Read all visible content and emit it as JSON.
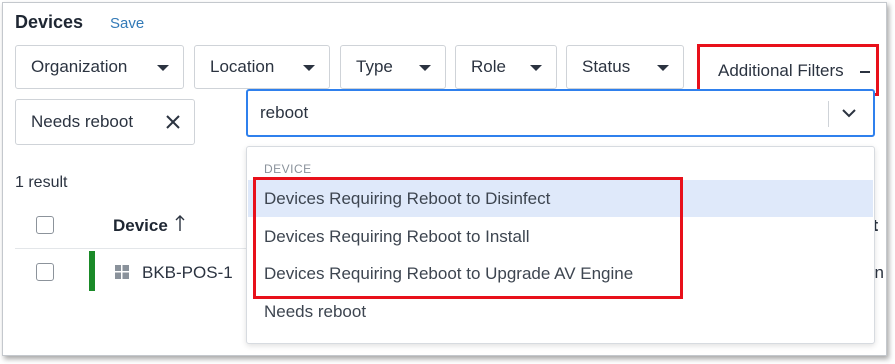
{
  "header": {
    "title": "Devices",
    "save_label": "Save"
  },
  "filters": {
    "organization": "Organization",
    "location": "Location",
    "type": "Type",
    "role": "Role",
    "status": "Status",
    "additional": "Additional Filters"
  },
  "active_chip": {
    "label": "Needs reboot"
  },
  "search": {
    "value": "reboot"
  },
  "dropdown": {
    "group_header": "DEVICE",
    "items": [
      {
        "label": "Devices Requiring Reboot to Disinfect"
      },
      {
        "label": "Devices Requiring Reboot to Install"
      },
      {
        "label": "Devices Requiring Reboot to Upgrade AV Engine"
      },
      {
        "label": "Needs reboot"
      }
    ]
  },
  "results": {
    "count_text": "1 result",
    "column_device": "Device",
    "column_right_fragment": "st",
    "rows": [
      {
        "device": "BKB-POS-1",
        "right_fragment": "on"
      }
    ]
  },
  "colors": {
    "accent_blue": "#2f80ed",
    "link_blue": "#337ab7",
    "highlight_red": "#e8101a",
    "status_green": "#1a8a28",
    "hover_bg": "#dfe9fa"
  }
}
